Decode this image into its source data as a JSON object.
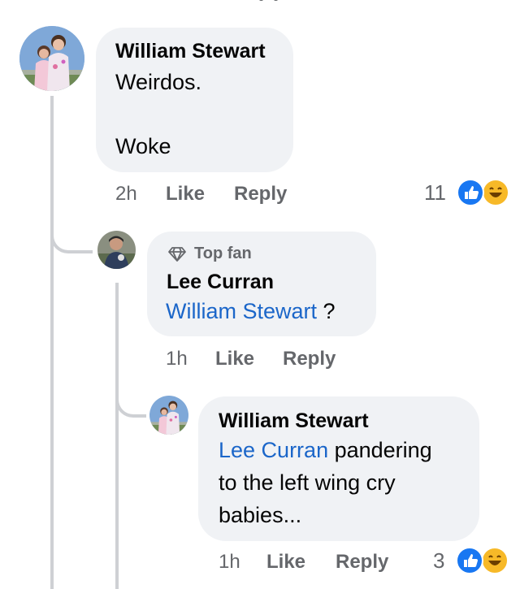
{
  "comments": [
    {
      "author": "William Stewart",
      "lines": [
        "Weirdos.",
        "",
        "Woke"
      ],
      "time": "2h",
      "like_label": "Like",
      "reply_label": "Reply",
      "reaction_count": "11",
      "reactions": [
        "like-icon",
        "haha-icon"
      ]
    },
    {
      "badge": "Top fan",
      "author": "Lee Curran",
      "mention": "William Stewart",
      "text_after": " ?",
      "time": "1h",
      "like_label": "Like",
      "reply_label": "Reply"
    },
    {
      "author": "William Stewart",
      "mention": "Lee Curran",
      "line1_after": " pandering",
      "line2": "to the left wing cry",
      "line3": "babies...",
      "time": "1h",
      "like_label": "Like",
      "reply_label": "Reply",
      "reaction_count": "3",
      "reactions": [
        "like-icon",
        "haha-icon"
      ]
    }
  ],
  "colors": {
    "bubble": "#f0f2f5",
    "mention": "#1b66c9",
    "meta": "#65676b",
    "thread_line": "#ced0d4",
    "like_blue": "#1877f2",
    "haha_yellow": "#f7b928"
  }
}
